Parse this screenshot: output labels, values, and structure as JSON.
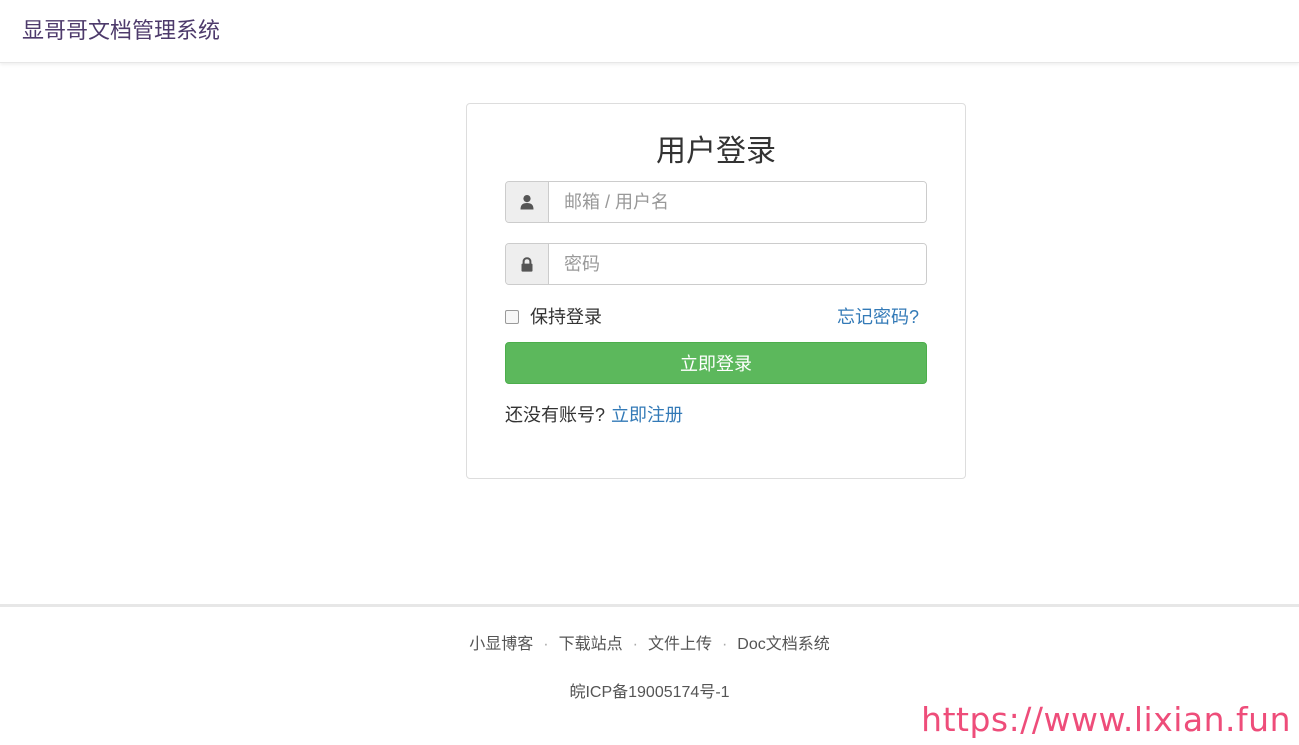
{
  "header": {
    "brand": "显哥哥文档管理系统"
  },
  "login": {
    "title": "用户登录",
    "email_placeholder": "邮箱 / 用户名",
    "password_placeholder": "密码",
    "remember_label": "保持登录",
    "forgot_label": "忘记密码?",
    "submit_label": "立即登录",
    "no_account_text": "还没有账号?",
    "register_label": "立即注册",
    "icons": {
      "email": "user-icon",
      "password": "lock-icon"
    }
  },
  "footer": {
    "links": [
      "小显博客",
      "下载站点",
      "文件上传",
      "Doc文档系统"
    ],
    "separator": "·",
    "icp": "皖ICP备19005174号-1"
  },
  "watermark": "https://www.lixian.fun",
  "colors": {
    "brand": "#4d3a6b",
    "primary_button": "#5cb85c",
    "link": "#337ab7",
    "watermark": "#ee4d7a"
  }
}
